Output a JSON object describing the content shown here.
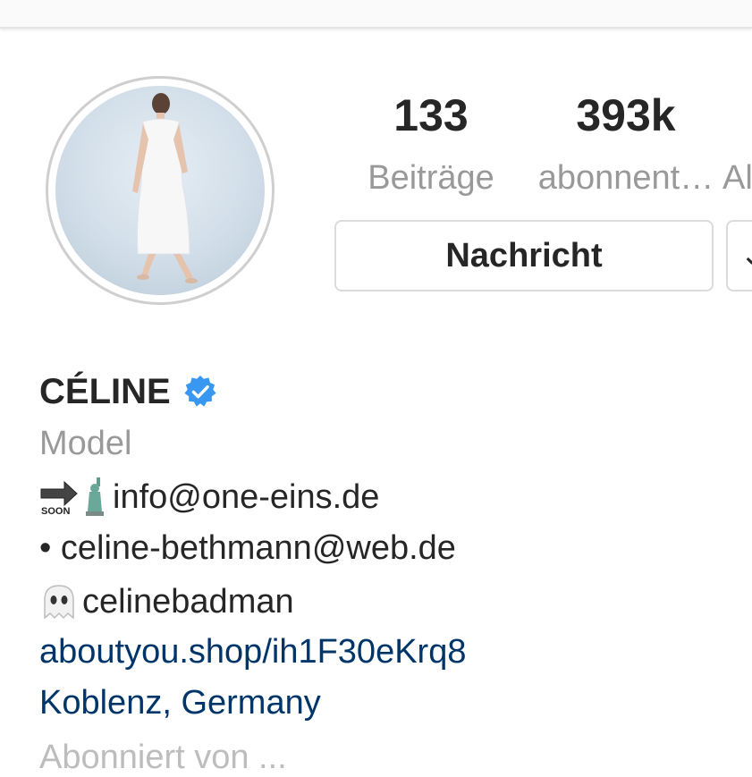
{
  "stats": {
    "posts": {
      "count": "133",
      "label": "Beiträge"
    },
    "followers": {
      "count": "393k",
      "label": "abonnent…"
    },
    "following": {
      "label": "Al"
    }
  },
  "buttons": {
    "message": "Nachricht"
  },
  "profile": {
    "name": "CÉLINE",
    "category": "Model",
    "bio_lines": [
      "info@one-eins.de",
      "• celine-bethmann@web.de",
      "celinebadman"
    ],
    "website": "aboutyou.shop/ih1F30eKrq8",
    "location": "Koblenz, Germany",
    "truncated_line": "Abonniert von ..."
  },
  "colors": {
    "link": "#003569",
    "verified": "#3897f0",
    "secondary_text": "#999999"
  },
  "icons": [
    "verified-badge-icon",
    "soon-arrow-icon",
    "statue-of-liberty-icon",
    "ghost-icon"
  ]
}
